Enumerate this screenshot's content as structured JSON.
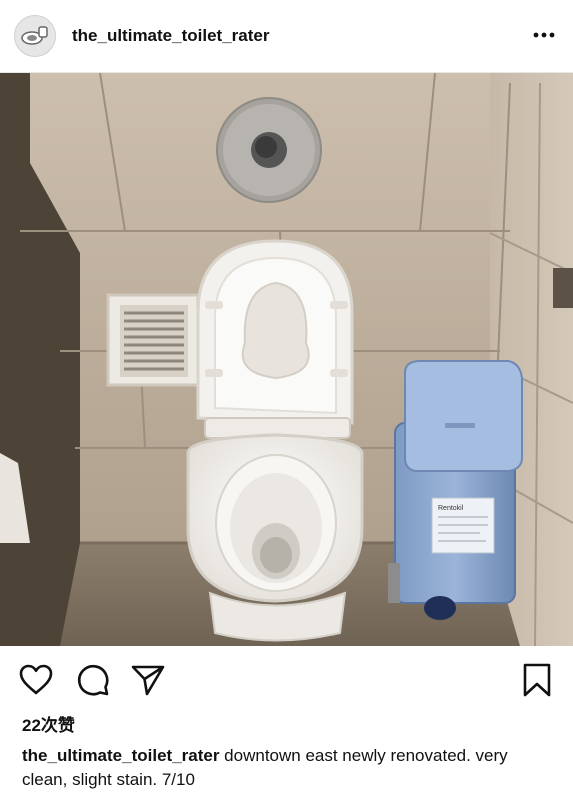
{
  "post": {
    "username": "the_ultimate_toilet_rater",
    "likes_text": "22次赞",
    "caption_username": "the_ultimate_toilet_rater",
    "caption_text": " downtown east newly renovated. very clean, slight stain. 7/10"
  },
  "icons": {
    "avatar": "toilet-avatar-icon",
    "more": "more-options-icon",
    "like": "heart-icon",
    "comment": "comment-bubble-icon",
    "share": "paper-plane-icon",
    "save": "bookmark-icon"
  },
  "photo": {
    "subject": "toilet-photo",
    "sanitary_bin_label": "Rentokil"
  }
}
